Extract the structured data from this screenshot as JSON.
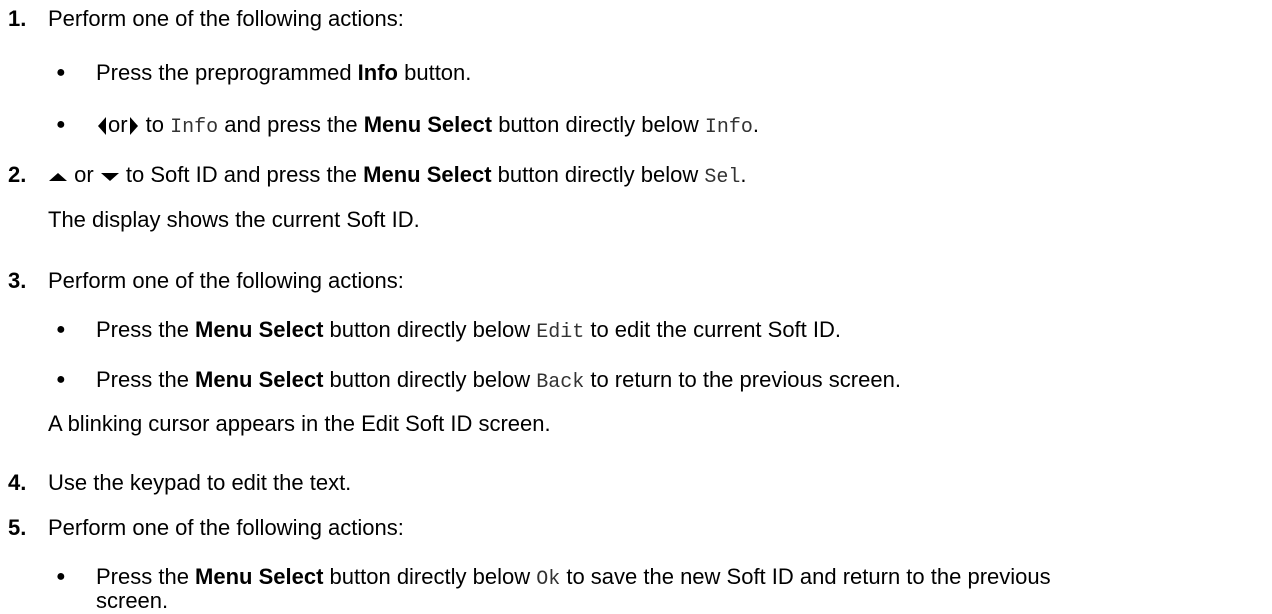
{
  "steps": [
    {
      "number": "1.",
      "text": "Perform one of the following actions:",
      "bullets": [
        {
          "pre": "Press the preprogrammed ",
          "bold": "Info",
          "post": " button."
        },
        {
          "left_icon": "left-arrow-icon",
          "or": "or",
          "right_icon": "right-arrow-icon",
          "to": " to ",
          "code1": "Info",
          "mid": " and press the ",
          "bold": "Menu Select",
          "post": " button directly below ",
          "code2": "Info",
          "end": "."
        }
      ]
    },
    {
      "number": "2.",
      "up_icon": "up-arrow-icon",
      "or": " or ",
      "down_icon": "down-arrow-icon",
      "pre": " to Soft ID and press the ",
      "bold": "Menu Select",
      "post": " button directly below ",
      "code": "Sel",
      "end": ".",
      "result": "The display shows the current Soft ID."
    },
    {
      "number": "3.",
      "text": "Perform one of the following actions:",
      "bullets": [
        {
          "pre": "Press the ",
          "bold": "Menu Select",
          "mid": " button directly below ",
          "code": "Edit",
          "post": " to edit the current Soft ID."
        },
        {
          "pre": "Press the ",
          "bold": "Menu Select",
          "mid": " button directly below ",
          "code": "Back",
          "post": " to return to the previous screen."
        }
      ],
      "result": "A blinking cursor appears in the Edit Soft ID screen."
    },
    {
      "number": "4.",
      "text": "Use the keypad to edit the text."
    },
    {
      "number": "5.",
      "text": "Perform one of the following actions:",
      "bullets": [
        {
          "pre": "Press the ",
          "bold": "Menu Select",
          "mid": " button directly below ",
          "code": "Ok",
          "post": " to save the new Soft ID and return to the previous",
          "wrap": "screen."
        }
      ]
    }
  ],
  "bullet_glyph": "●"
}
